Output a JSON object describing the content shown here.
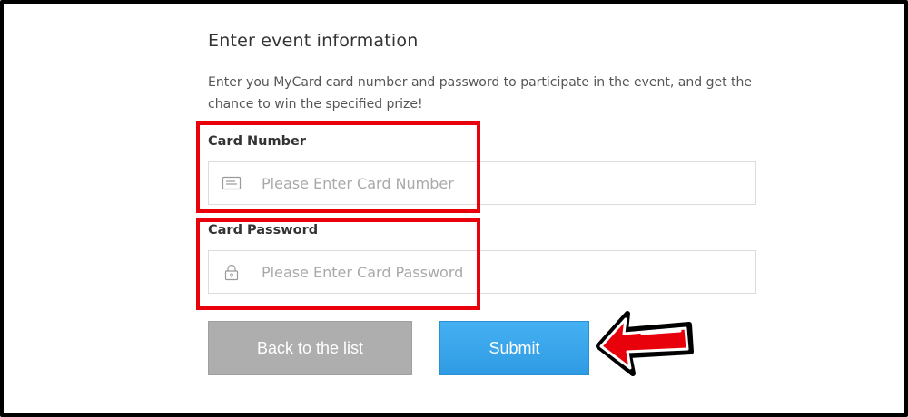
{
  "form": {
    "title": "Enter event information",
    "description": "Enter you MyCard card number and password to participate in the event, and get the chance to win the specified prize!",
    "card_number": {
      "label": "Card Number",
      "placeholder": "Please Enter Card Number",
      "value": "",
      "icon": "card-icon"
    },
    "card_password": {
      "label": "Card Password",
      "placeholder": "Please Enter Card Password",
      "value": "",
      "icon": "lock-icon"
    },
    "buttons": {
      "back_label": "Back to the list",
      "submit_label": "Submit"
    }
  },
  "colors": {
    "highlight": "#e8000b",
    "submit": "#3aa6ec",
    "back": "#aeaeae"
  }
}
